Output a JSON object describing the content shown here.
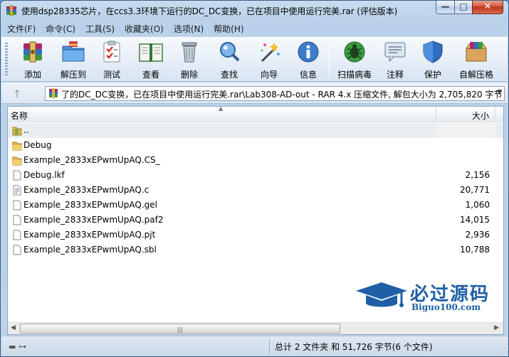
{
  "window": {
    "title": "使用dsp28335芯片，在ccs3.3环境下运行的DC_DC变换，已在项目中使用运行完美.rar (评估版本)",
    "controls": {
      "minimize": "—",
      "maximize": "□",
      "close": "✕"
    }
  },
  "menu": [
    {
      "label": "文件(F)"
    },
    {
      "label": "命令(C)"
    },
    {
      "label": "工具(S)"
    },
    {
      "label": "收藏夹(O)"
    },
    {
      "label": "选项(N)"
    },
    {
      "label": "帮助(H)"
    }
  ],
  "toolbar": [
    {
      "label": "添加",
      "icon": "add-archive-icon"
    },
    {
      "label": "解压到",
      "icon": "extract-to-icon"
    },
    {
      "label": "测试",
      "icon": "test-icon"
    },
    {
      "label": "查看",
      "icon": "view-icon"
    },
    {
      "label": "删除",
      "icon": "delete-icon"
    },
    {
      "label": "查找",
      "icon": "find-icon"
    },
    {
      "label": "向导",
      "icon": "wizard-icon"
    },
    {
      "label": "信息",
      "icon": "info-icon"
    },
    {
      "label": "扫描病毒",
      "icon": "virus-scan-icon"
    },
    {
      "label": "注释",
      "icon": "comment-icon"
    },
    {
      "label": "保护",
      "icon": "protect-icon"
    },
    {
      "label": "自解压格",
      "icon": "sfx-icon"
    }
  ],
  "address": {
    "up_glyph": "🡑",
    "path": "了的DC_DC变换，已在项目中使用运行完美.rar\\Lab308-AD-out - RAR 4.x 压缩文件, 解包大小为 2,705,820 字节"
  },
  "columns": {
    "name": "名称",
    "size": "大小"
  },
  "files": [
    {
      "name": "..",
      "size": "",
      "type": "parent"
    },
    {
      "name": "Debug",
      "size": "",
      "type": "folder"
    },
    {
      "name": "Example_2833xEPwmUpAQ.CS_",
      "size": "",
      "type": "folder"
    },
    {
      "name": "Debug.lkf",
      "size": "2,156",
      "type": "file"
    },
    {
      "name": "Example_2833xEPwmUpAQ.c",
      "size": "20,771",
      "type": "c-file"
    },
    {
      "name": "Example_2833xEPwmUpAQ.gel",
      "size": "1,060",
      "type": "file"
    },
    {
      "name": "Example_2833xEPwmUpAQ.paf2",
      "size": "14,015",
      "type": "file"
    },
    {
      "name": "Example_2833xEPwmUpAQ.pjt",
      "size": "2,936",
      "type": "file"
    },
    {
      "name": "Example_2833xEPwmUpAQ.sbl",
      "size": "10,788",
      "type": "file"
    }
  ],
  "status": {
    "summary": "总计 2 文件夹 和 51,726 字节(6 个文件)"
  },
  "watermark": {
    "title": "必过源码",
    "url": "Biguo100.com"
  },
  "colors": {
    "accent": "#1f5fa6",
    "folder": "#e8b84a",
    "selection": "#eaeef3"
  }
}
